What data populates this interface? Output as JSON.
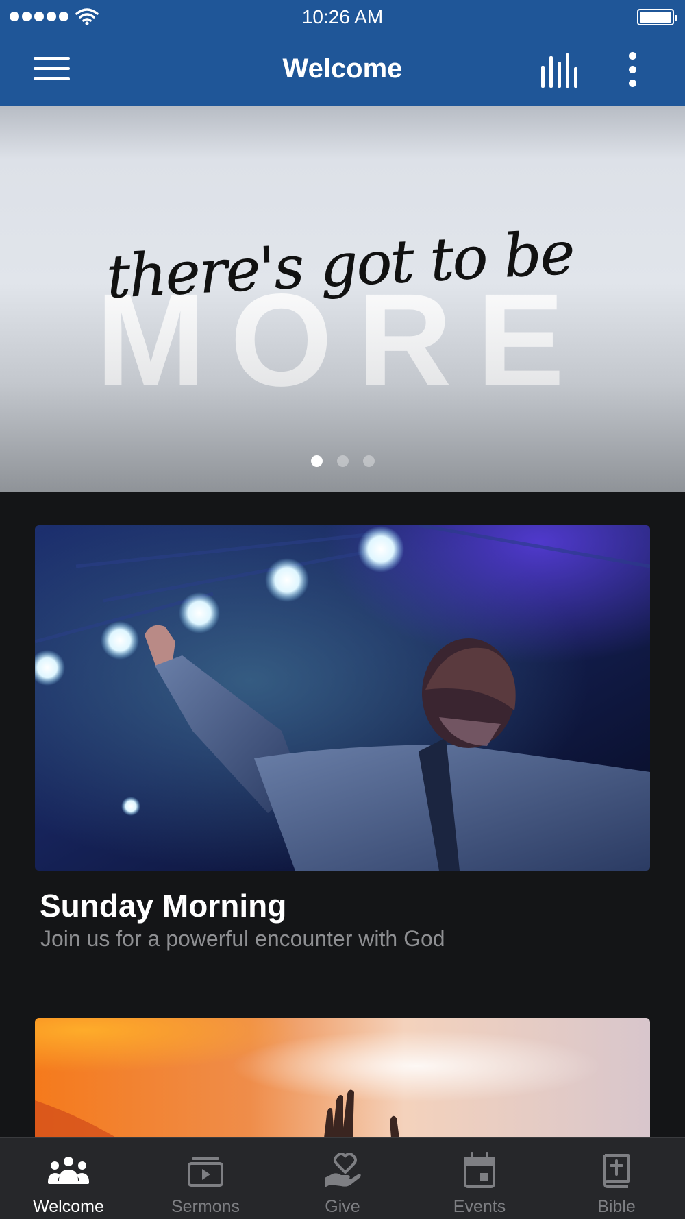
{
  "status_bar": {
    "time": "10:26 AM",
    "signal_icon": "signal-dots-icon",
    "wifi_icon": "wifi-icon",
    "battery_icon": "battery-icon",
    "battery_level": 1.0
  },
  "nav": {
    "title": "Welcome",
    "menu_icon": "hamburger-menu-icon",
    "chart_icon": "bar-chart-icon",
    "more_icon": "more-vertical-icon"
  },
  "hero": {
    "script_text": "there's got to be",
    "big_text": "MORE",
    "slide_count": 3,
    "active_slide": 1
  },
  "cards": [
    {
      "title": "Sunday Morning",
      "subtitle": "Join us for a powerful encounter with God",
      "image": "concert-worship-photo"
    },
    {
      "image": "sunset-hands-photo"
    }
  ],
  "tabs": [
    {
      "label": "Welcome",
      "icon": "people-icon",
      "active": true
    },
    {
      "label": "Sermons",
      "icon": "video-library-icon",
      "active": false
    },
    {
      "label": "Give",
      "icon": "hand-heart-icon",
      "active": false
    },
    {
      "label": "Events",
      "icon": "calendar-icon",
      "active": false
    },
    {
      "label": "Bible",
      "icon": "bible-icon",
      "active": false
    }
  ],
  "colors": {
    "brand": "#1f5698",
    "background": "#141517",
    "tab_bar": "#26272a",
    "tab_inactive": "#7e7f83",
    "subtitle": "#8e8f92"
  }
}
